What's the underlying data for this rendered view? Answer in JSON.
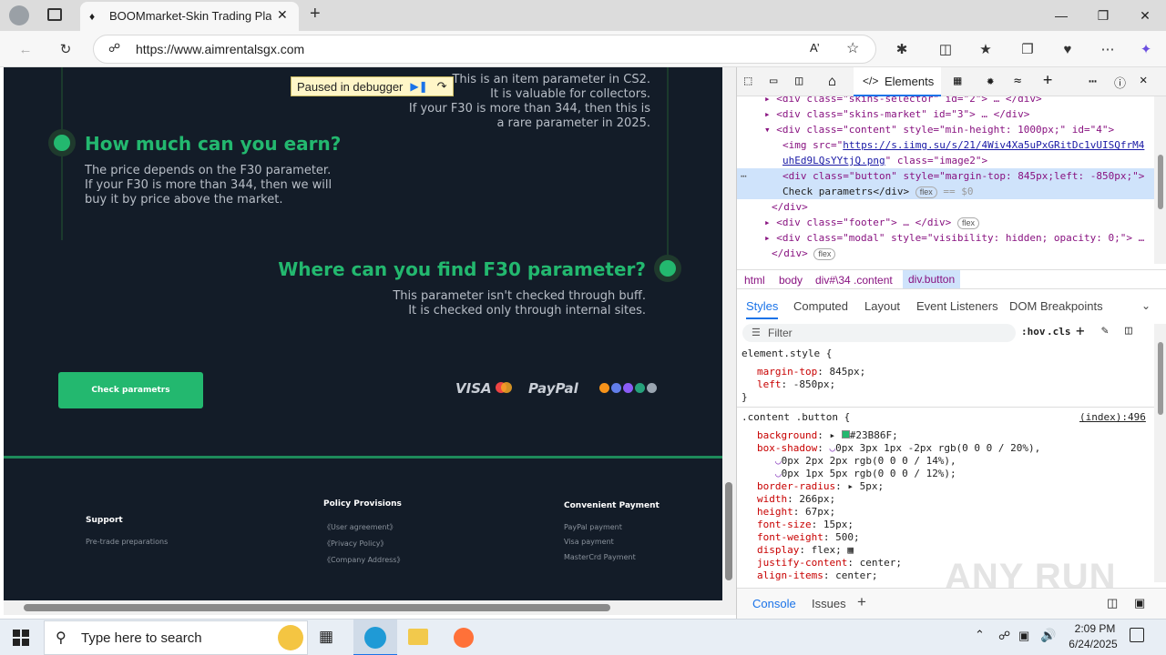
{
  "browser": {
    "tab_title": "BOOMmarket-Skin Trading Platfo",
    "url": "https://www.aimrentalsgx.com"
  },
  "debugger": {
    "label": "Paused in debugger"
  },
  "page": {
    "intro_lines": [
      "This is an item parameter in CS2.",
      "It is valuable for collectors.",
      "If your F30 is more than 344, then this is",
      "a rare parameter in 2025."
    ],
    "earn_title": "How much can you earn?",
    "earn_lines": [
      "The price depends on the F30 parameter.",
      "If your F30 is more than 344, then we will",
      "buy it by price above the market."
    ],
    "find_title": "Where can you find F30 parameter?",
    "find_lines": [
      "This parameter isn't checked through buff.",
      "It is checked only through internal sites."
    ],
    "button_label": "Check parametrs",
    "payment_logos": [
      "VISA",
      "PayPal"
    ]
  },
  "footer": {
    "support": {
      "title": "Support",
      "links": [
        "Pre-trade preparations"
      ]
    },
    "policy": {
      "title": "Policy Provisions",
      "links": [
        "《User agreement》",
        "《Privacy Policy》",
        "《Company Address》"
      ]
    },
    "payment": {
      "title": "Convenient Payment",
      "links": [
        "PayPal payment",
        "Visa payment",
        "MasterCrd Payment"
      ]
    }
  },
  "devtools": {
    "active_tab": "Elements",
    "dom_lines": [
      "<div class=\"skins-selector\" id=\"2\"> … </div>",
      "<div class=\"skins-market\" id=\"3\"> … </div>",
      "<div class=\"content\" style=\"min-height: 1000px;\" id=\"4\">",
      "<img src=\"",
      "https://s.iimg.su/s/21/4Wiv4Xa5uPxGRitDc1vUISQfrM4",
      "uhEd9LQsYYtjQ.png",
      "\" class=\"image2\">",
      "<div class=\"button\" style=\"margin-top: 845px;left: -850px;\">",
      "Check parametrs</div>",
      "== $0",
      "</div>",
      "<div class=\"footer\"> … </div>",
      "<div class=\"modal\" style=\"visibility: hidden; opacity: 0;\"> …",
      "</div>",
      "flex"
    ],
    "breadcrumbs": [
      "html",
      "body",
      "div#\\34 .content",
      "div.button"
    ],
    "style_tabs": [
      "Styles",
      "Computed",
      "Layout",
      "Event Listeners",
      "DOM Breakpoints"
    ],
    "filter_placeholder": "Filter",
    "filter_tools": [
      ":hov",
      ".cls"
    ],
    "element_style": {
      "selector": "element.style {",
      "props": [
        [
          "margin-top",
          "845px;"
        ],
        [
          "left",
          "-850px;"
        ]
      ]
    },
    "button_rule": {
      "selector": ".content .button {",
      "source": "(index):496",
      "props": [
        [
          "background",
          "#23B86F;"
        ],
        [
          "box-shadow",
          "0px 3px 1px -2px rgb(0 0 0 / 20%),"
        ],
        [
          "",
          "0px 2px 2px rgb(0 0 0 / 14%),"
        ],
        [
          "",
          "0px 1px 5px rgb(0 0 0 / 12%);"
        ],
        [
          "border-radius",
          "5px;"
        ],
        [
          "width",
          "266px;"
        ],
        [
          "height",
          "67px;"
        ],
        [
          "font-size",
          "15px;"
        ],
        [
          "font-weight",
          "500;"
        ],
        [
          "display",
          "flex;"
        ],
        [
          "justify-content",
          "center;"
        ],
        [
          "align-items",
          "center;"
        ]
      ]
    },
    "drawer_tabs": [
      "Console",
      "Issues"
    ]
  },
  "taskbar": {
    "search_placeholder": "Type here to search",
    "time": "2:09 PM",
    "date": "6/24/2025"
  },
  "watermark": "ANY RUN",
  "colors": {
    "accent": "#23b86f",
    "page_bg": "#131c28"
  }
}
